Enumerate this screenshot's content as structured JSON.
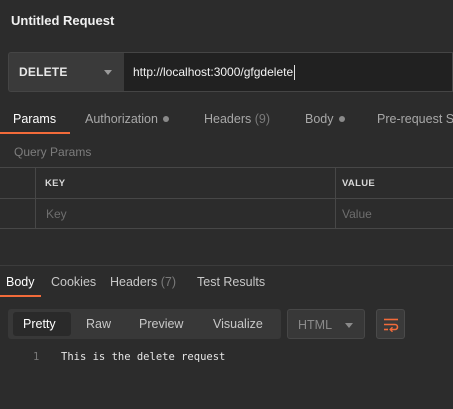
{
  "request": {
    "title": "Untitled Request",
    "method": "DELETE",
    "url": "http://localhost:3000/gfgdelete"
  },
  "request_tabs": [
    {
      "label": "Params",
      "active": true
    },
    {
      "label": "Authorization",
      "has_dot": true
    },
    {
      "label": "Headers",
      "count": "(9)"
    },
    {
      "label": "Body",
      "has_dot": true
    },
    {
      "label": "Pre-request S"
    }
  ],
  "query_params": {
    "section_label": "Query Params",
    "columns": [
      "KEY",
      "VALUE"
    ],
    "placeholders": [
      "Key",
      "Value"
    ]
  },
  "response_tabs": [
    {
      "label": "Body",
      "active": true
    },
    {
      "label": "Cookies"
    },
    {
      "label": "Headers",
      "count": "(7)"
    },
    {
      "label": "Test Results"
    }
  ],
  "response_toolbar": {
    "views": [
      "Pretty",
      "Raw",
      "Preview",
      "Visualize"
    ],
    "active_view": "Pretty",
    "format": "HTML",
    "wrap_icon": "wrap-lines-icon"
  },
  "response_body": {
    "lines": [
      {
        "number": "1",
        "text": "This is the delete request"
      }
    ]
  },
  "colors": {
    "background": "#2c2c2c",
    "accent": "#f26b3a",
    "input_background": "#212121",
    "text": "#e0e0e0",
    "muted_text": "#7d7d7d"
  }
}
